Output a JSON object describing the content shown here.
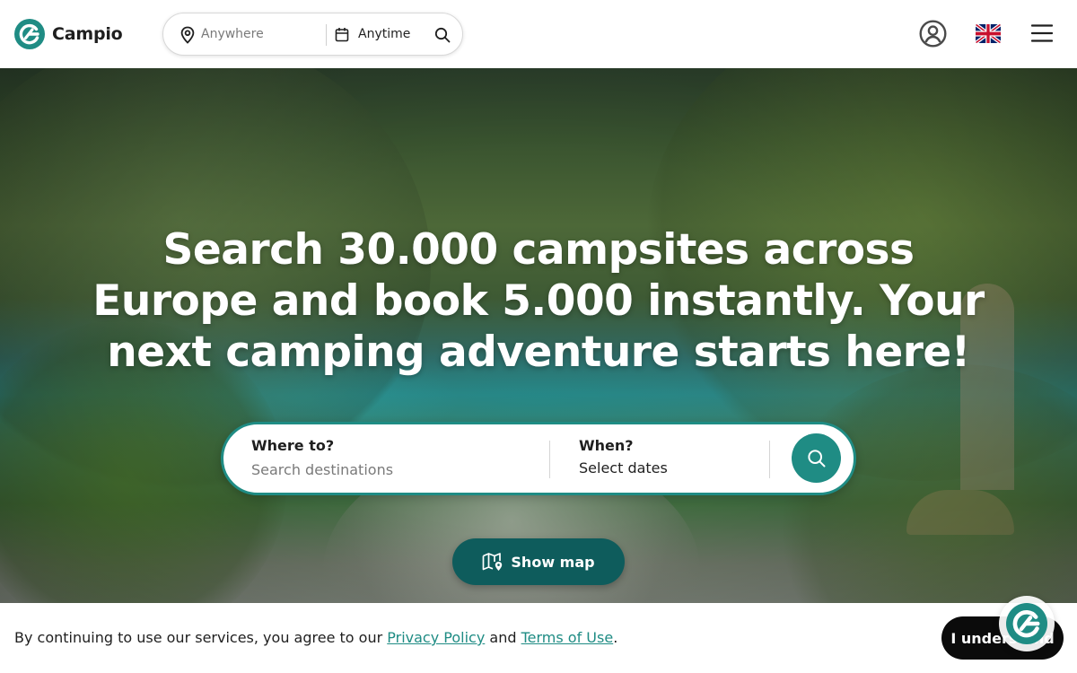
{
  "brand": {
    "name": "Campio",
    "accent": "#1f8c84",
    "dark_teal": "#0e5c5c"
  },
  "header": {
    "mini_search": {
      "where": "Anywhere",
      "when": "Anytime"
    },
    "icons": {
      "profile": "user-circle-icon",
      "language": "uk-flag-icon",
      "menu": "hamburger-menu-icon"
    }
  },
  "hero": {
    "headline": "Search 30.000 campsites across Europe and book 5.000 instantly. Your next camping adventure starts here!",
    "search": {
      "where_label": "Where to?",
      "where_placeholder": "Search destinations",
      "when_label": "When?",
      "when_value": "Select dates"
    },
    "show_map_label": "Show map"
  },
  "cookie": {
    "text_before": "By continuing to use our services, you agree to our ",
    "privacy_label": "Privacy Policy",
    "text_middle": " and ",
    "terms_label": "Terms of Use",
    "text_after": ".",
    "button_label": "I understand"
  }
}
